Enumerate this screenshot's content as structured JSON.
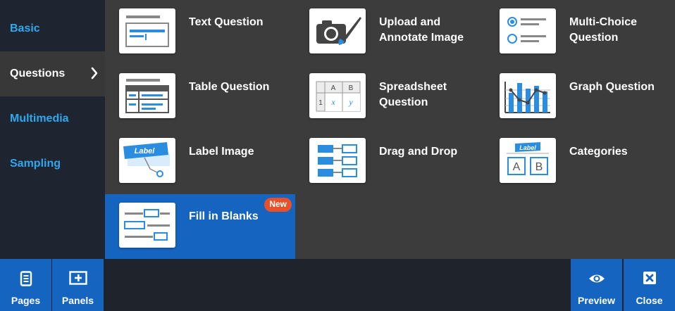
{
  "sidebar": {
    "items": [
      {
        "label": "Basic"
      },
      {
        "label": "Questions"
      },
      {
        "label": "Multimedia"
      },
      {
        "label": "Sampling"
      }
    ]
  },
  "tiles": [
    {
      "label": "Text Question"
    },
    {
      "label": "Upload and Annotate Image"
    },
    {
      "label": "Multi-Choice Question"
    },
    {
      "label": "Table Question"
    },
    {
      "label": "Spreadsheet Question"
    },
    {
      "label": "Graph Question"
    },
    {
      "label": "Label Image"
    },
    {
      "label": "Drag and Drop"
    },
    {
      "label": "Categories"
    },
    {
      "label": "Fill in Blanks",
      "badge": "New"
    }
  ],
  "thumb_text": {
    "spreadsheet_col_a": "A",
    "spreadsheet_col_b": "B",
    "spreadsheet_row_1": "1",
    "spreadsheet_x": "x",
    "spreadsheet_y": "y",
    "label_image_tag": "Label",
    "categories_tag": "Label",
    "categories_a": "A",
    "categories_b": "B"
  },
  "toolbar": {
    "pages_label": "Pages",
    "panels_label": "Panels",
    "preview_label": "Preview",
    "close_label": "Close"
  },
  "colors": {
    "accent_blue": "#1565c0",
    "link_blue": "#2da8ee",
    "badge_orange": "#e8502a",
    "panel_bg": "#3c3c3c"
  }
}
